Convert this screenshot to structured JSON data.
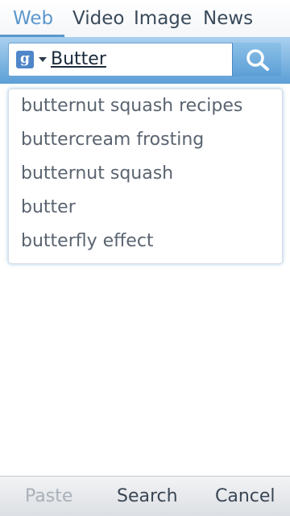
{
  "tabs": [
    {
      "label": "Web",
      "active": true
    },
    {
      "label": "Video",
      "active": false
    },
    {
      "label": "Image",
      "active": false
    },
    {
      "label": "News",
      "active": false
    }
  ],
  "search": {
    "engine_icon": "google-g-icon",
    "engine_letter": "g",
    "query": "Butter",
    "button_icon": "magnifier-icon"
  },
  "suggestions": [
    "butternut squash recipes",
    "buttercream frosting",
    "butternut squash",
    "butter",
    "butterfly effect"
  ],
  "softkeys": {
    "paste": "Paste",
    "search": "Search",
    "cancel": "Cancel"
  },
  "colors": {
    "accent": "#5b97cc",
    "band_top": "#a9d0ef",
    "band_bottom": "#5c9fd6"
  }
}
